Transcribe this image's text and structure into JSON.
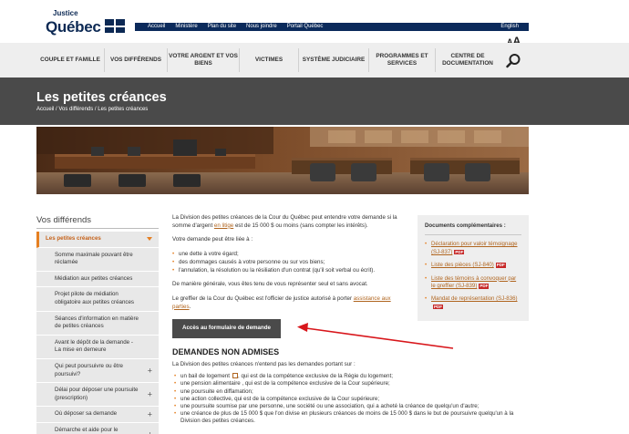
{
  "brand": {
    "line1": "Justice",
    "line2": "Québec"
  },
  "topbar": {
    "links": [
      "Accueil",
      "Ministère",
      "Plan du site",
      "Nous joindre",
      "Portail Québec"
    ],
    "language": "English"
  },
  "font_size": {
    "small": "A",
    "large": "A"
  },
  "nav": {
    "items": [
      {
        "label": "COUPLE ET FAMILLE"
      },
      {
        "label": "VOS DIFFÉRENDS"
      },
      {
        "label": "VOTRE ARGENT ET VOS BIENS"
      },
      {
        "label": "VICTIMES"
      },
      {
        "label": "SYSTÈME JUDICIAIRE"
      },
      {
        "label": "PROGRAMMES ET SERVICES"
      },
      {
        "label": "CENTRE DE DOCUMENTATION"
      }
    ],
    "search_icon": "search-icon"
  },
  "page": {
    "title": "Les petites créances",
    "breadcrumb": "Accueil / Vos différends / Les petites créances"
  },
  "sidebar": {
    "title": "Vos différends",
    "active": "Les petites créances",
    "items": [
      {
        "label": "Somme maximale pouvant être réclamée",
        "expandable": false
      },
      {
        "label": "Médiation aux petites créances",
        "expandable": false
      },
      {
        "label": "Projet pilote de médiation obligatoire aux petites créances",
        "expandable": false
      },
      {
        "label": "Séances d'information en matière de petites créances",
        "expandable": false
      },
      {
        "label": "Avant le dépôt de la demande - La mise en demeure",
        "expandable": false
      },
      {
        "label": "Qui peut poursuivre ou être poursuivi?",
        "expandable": true
      },
      {
        "label": "Délai pour déposer une poursuite (prescription)",
        "expandable": true
      },
      {
        "label": "Où déposer sa demande",
        "expandable": true
      },
      {
        "label": "Démarche et aide pour le demandeur",
        "expandable": true
      }
    ]
  },
  "main": {
    "intro_before": "La Division des petites créances de la Cour du Québec peut entendre votre demande si la somme d'argent ",
    "intro_link": "en litige",
    "intro_after": " est de 15 000 $ ou moins (sans compter les intérêts).",
    "list_intro": "Votre demande peut être liée à :",
    "list": [
      "une dette à votre égard;",
      "des dommages causés à votre personne ou sur vos biens;",
      "l'annulation, la résolution ou la résiliation d'un contrat (qu'il soit verbal ou écrit)."
    ],
    "representation": "De manière générale, vous êtes tenu de vous représenter seul et sans avocat.",
    "clerk_before": "Le greffier de la Cour du Québec est l'officier de justice autorisé à porter ",
    "clerk_link": "assistance aux parties",
    "clerk_after": ".",
    "cta": "Accès au formulaire de demande"
  },
  "section": {
    "heading": "DEMANDES NON ADMISES",
    "intro": "La Division des petites créances n'entend pas les demandes portant sur :",
    "item1_before": "un ",
    "item1_link": "bail de logement",
    "item1_after": ", qui est de la compétence exclusive de la Régie du logement;",
    "items": [
      "une pension alimentaire , qui est de la compétence exclusive de la Cour supérieure;",
      "une poursuite en diffamation;",
      "une action collective, qui est de la compétence exclusive de la Cour supérieure;",
      "une poursuite soumise par une personne, une société ou une association, qui a acheté la créance de quelqu'un d'autre;",
      "une créance de plus de 15 000 $ que l'on divise en plusieurs créances de moins de 15 000 $ dans le but de poursuivre quelqu'un à la Division des petites créances."
    ]
  },
  "docs": {
    "title": "Documents complémentaires :",
    "items": [
      {
        "label": "Déclaration pour valoir témoignage (SJ-837)",
        "badge": "PDF"
      },
      {
        "label": "Liste des pièces (SJ-840)",
        "badge": "PDF"
      },
      {
        "label": "Liste des témoins à convoquer par le greffier (SJ-839)",
        "badge": "PDF"
      },
      {
        "label": "Mandat de représentation (SJ-836)",
        "badge": "PDF"
      }
    ]
  },
  "colors": {
    "navy": "#0b2a5b",
    "accent": "#e57f21",
    "band": "#4a4a4a",
    "link": "#b0651f",
    "annotation_arrow": "#d8161b"
  }
}
